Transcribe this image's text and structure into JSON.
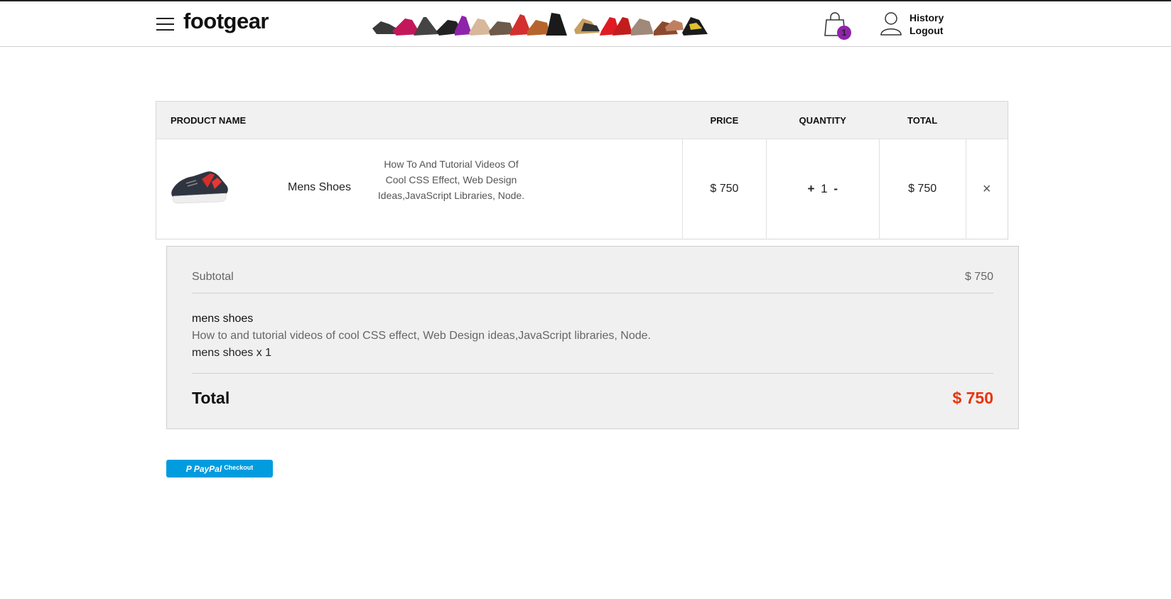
{
  "header": {
    "logo": "footgear",
    "menu_icon": "hamburger-icon",
    "cart_icon": "shopping-bag-icon",
    "cart_count": "1",
    "badge_color": "#8e24aa",
    "user_icon": "user-icon",
    "history_label": "History",
    "logout_label": "Logout"
  },
  "cart": {
    "columns": {
      "product": "PRODUCT NAME",
      "price": "PRICE",
      "quantity": "QUANTITY",
      "total": "TOTAL"
    },
    "item": {
      "name": "Mens Shoes",
      "description": "How To And Tutorial Videos Of Cool CSS Effect, Web Design Ideas,JavaScript Libraries, Node.",
      "price": "$ 750",
      "quantity": "1",
      "plus": "+",
      "minus": "-",
      "total": "$ 750",
      "remove": "×"
    }
  },
  "summary": {
    "subtotal_label": "Subtotal",
    "subtotal_value": "$ 750",
    "item_name": "mens shoes",
    "item_desc": "How to and tutorial videos of cool CSS effect, Web Design ideas,JavaScript libraries, Node.",
    "item_qty": "mens shoes x 1",
    "total_label": "Total",
    "total_value": "$ 750",
    "total_color": "#e8340c"
  },
  "paypal": {
    "brand": "PayPal",
    "label": "Checkout",
    "color": "#009cde"
  }
}
